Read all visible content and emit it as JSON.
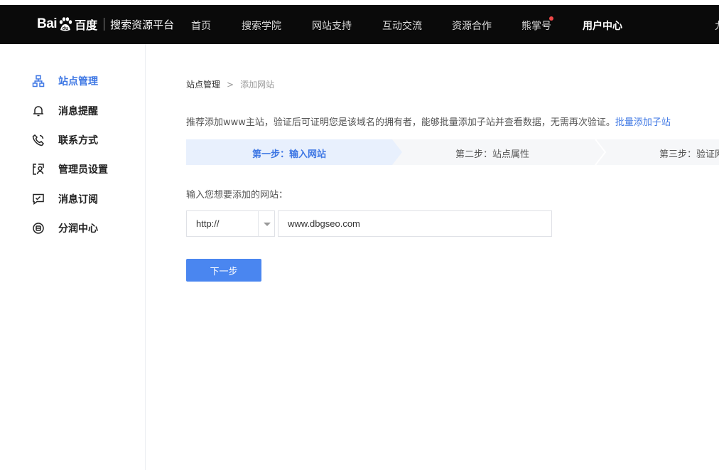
{
  "header": {
    "logo_text_en": "Bai",
    "logo_text_du": "du",
    "logo_text_cn": "百度",
    "platform_name": "搜索资源平台",
    "nav": [
      {
        "label": "首页",
        "active": false
      },
      {
        "label": "搜索学院",
        "active": false
      },
      {
        "label": "网站支持",
        "active": false
      },
      {
        "label": "互动交流",
        "active": false
      },
      {
        "label": "资源合作",
        "active": false
      },
      {
        "label": "熊掌号",
        "active": false,
        "badge_dot": true
      },
      {
        "label": "用户中心",
        "active": true
      }
    ],
    "overflow_text": "九"
  },
  "sidebar": {
    "items": [
      {
        "label": "站点管理",
        "icon": "sitemap-icon",
        "active": true
      },
      {
        "label": "消息提醒",
        "icon": "bell-icon",
        "active": false
      },
      {
        "label": "联系方式",
        "icon": "phone-icon",
        "active": false
      },
      {
        "label": "管理员设置",
        "icon": "admin-icon",
        "active": false
      },
      {
        "label": "消息订阅",
        "icon": "message-check-icon",
        "active": false
      },
      {
        "label": "分润中心",
        "icon": "coin-icon",
        "active": false
      }
    ]
  },
  "breadcrumb": {
    "parent": "站点管理",
    "separator": ">",
    "current": "添加网站"
  },
  "notice": {
    "text": "推荐添加www主站，验证后可证明您是该域名的拥有者，能够批量添加子站并查看数据，无需再次验证。",
    "link": "批量添加子站"
  },
  "steps": [
    {
      "label": "第一步：输入网站",
      "active": true
    },
    {
      "label": "第二步：站点属性",
      "active": false
    },
    {
      "label": "第三步：验证网站",
      "active": false
    }
  ],
  "form": {
    "label": "输入您想要添加的网站：",
    "protocol_value": "http://",
    "url_value": "www.dbgseo.com",
    "next_button": "下一步"
  },
  "colors": {
    "accent": "#3e77e4",
    "button": "#4a86f0",
    "topbar": "#0a0a0a",
    "step_active_bg": "#e8f0fd",
    "badge": "#f04848"
  }
}
